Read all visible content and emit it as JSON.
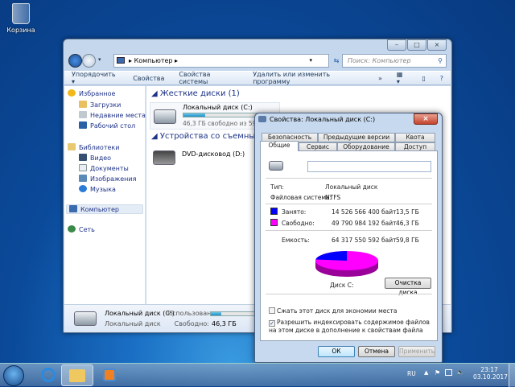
{
  "desktop": {
    "recycle_bin": "Корзина"
  },
  "explorer": {
    "address": "Компьютер",
    "search_placeholder": "Поиск: Компьютер",
    "toolbar": [
      "Упорядочить ▾",
      "Свойства",
      "Свойства системы",
      "Удалить или изменить программу",
      "»"
    ],
    "nav": {
      "favorites": "Избранное",
      "downloads": "Загрузки",
      "recent": "Недавние места",
      "desktop": "Рабочий стол",
      "libraries": "Библиотеки",
      "video": "Видео",
      "documents": "Документы",
      "images": "Изображения",
      "music": "Музыка",
      "computer": "Компьютер",
      "network": "Сеть"
    },
    "groups": {
      "hdd": "Жесткие диски (1)",
      "removable": "Устройства со съемными но"
    },
    "drive_c": {
      "name": "Локальный диск (C:)",
      "free_text": "46,3 ГБ свободно из 59,8 ГБ",
      "used_fraction": 0.23
    },
    "drive_d": {
      "name": "DVD-дисковод (D:)"
    },
    "details": {
      "name": "Локальный диск (C:)",
      "type": "Локальный диск",
      "used_label": "Использовано:",
      "free_label": "Свободно:",
      "free_value": "46,3 ГБ"
    }
  },
  "dialog": {
    "title": "Свойства: Локальный диск (C:)",
    "tabs_row1": [
      "Безопасность",
      "Предыдущие версии",
      "Квота"
    ],
    "tabs_row2": [
      "Общие",
      "Сервис",
      "Оборудование",
      "Доступ"
    ],
    "label_value": "",
    "type_label": "Тип:",
    "type_value": "Локальный диск",
    "fs_label": "Файловая система:",
    "fs_value": "NTFS",
    "used_label": "Занято:",
    "used_bytes": "14 526 566 400 байт",
    "used_gb": "13,5 ГБ",
    "free_label": "Свободно:",
    "free_bytes": "49 790 984 192 байт",
    "free_gb": "46,3 ГБ",
    "cap_label": "Емкость:",
    "cap_bytes": "64 317 550 592 байт",
    "cap_gb": "59,8 ГБ",
    "disk_label": "Диск C:",
    "cleanup": "Очистка диска",
    "compress": "Сжать этот диск для экономии места",
    "index": "Разрешить индексировать содержимое файлов на этом диске в дополнение к свойствам файла",
    "ok": "ОК",
    "cancel": "Отмена",
    "apply": "Применить",
    "colors": {
      "used": "#0000ff",
      "free": "#ff00ff"
    }
  },
  "tray": {
    "lang": "RU",
    "time": "23:17",
    "date": "03.10.2017"
  }
}
